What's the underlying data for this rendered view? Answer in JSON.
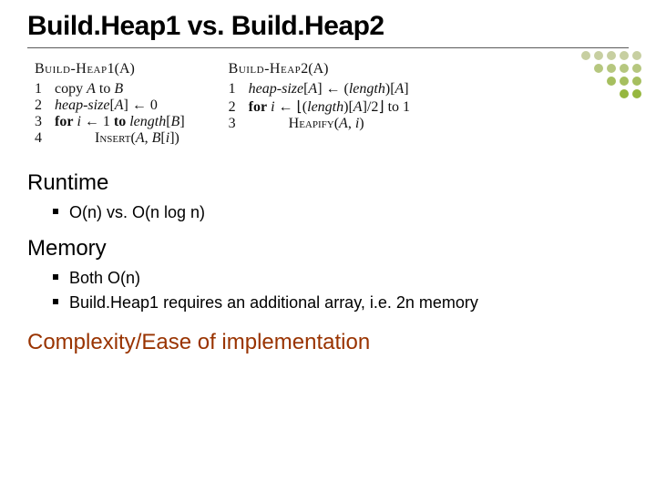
{
  "title": "Build.Heap1 vs. Build.Heap2",
  "algo1": {
    "header_proc": "Build-Heap",
    "header_suffix": "1(A)",
    "lines": [
      {
        "n": "1",
        "indent": 0,
        "html": "copy <i>A</i> to <i>B</i>"
      },
      {
        "n": "2",
        "indent": 0,
        "html": "<i>heap-size</i>[<i>A</i>] ← 0"
      },
      {
        "n": "3",
        "indent": 0,
        "html": "<b>for</b> <i>i</i> ← 1 <b>to</b> <i>length</i>[<i>B</i>]"
      },
      {
        "n": "4",
        "indent": 2,
        "html": "<span style=\"font-variant:small-caps\">Insert</span>(<i>A</i>, <i>B</i>[<i>i</i>])"
      }
    ]
  },
  "algo2": {
    "header_proc": "Build-Heap",
    "header_suffix": "2(A)",
    "lines": [
      {
        "n": "1",
        "indent": 0,
        "html": "<i>heap-size</i>[<i>A</i>] ← (<i>length</i>)[<i>A</i>]"
      },
      {
        "n": "2",
        "indent": 0,
        "html": "<b>for</b> <i>i</i> ← ⌊(<i>length</i>)[<i>A</i>]/2⌋ to 1"
      },
      {
        "n": "3",
        "indent": 2,
        "html": "<span style=\"font-variant:small-caps\">Heapify</span>(<i>A</i>, <i>i</i>)"
      }
    ]
  },
  "sections": {
    "runtime": "Runtime",
    "memory": "Memory",
    "complexity": "Complexity/Ease of implementation"
  },
  "runtime_bullets": [
    "O(n) vs. O(n log n)"
  ],
  "memory_bullets": [
    "Both O(n)",
    "Build.Heap1 requires an additional array, i.e. 2n memory"
  ],
  "dots": {
    "rows": [
      [
        "#c7cfa1",
        "#c7cfa1",
        "#c7cfa1",
        "#c7cfa1",
        "#c7cfa1"
      ],
      [
        "#b6c77f",
        "#b6c77f",
        "#b6c77f",
        "#b6c77f"
      ],
      [
        "#a6bf5f",
        "#a6bf5f",
        "#a6bf5f"
      ],
      [
        "#96b73f",
        "#96b73f"
      ]
    ]
  }
}
